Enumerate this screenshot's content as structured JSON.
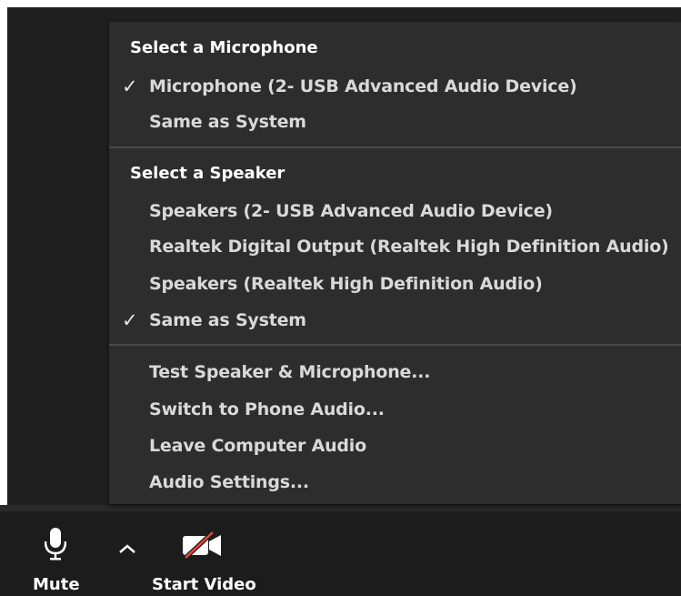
{
  "menu": {
    "microphone_header": "Select a Microphone",
    "microphones": [
      {
        "label": "Microphone (2- USB Advanced Audio Device)",
        "checked": true
      },
      {
        "label": "Same as System",
        "checked": false
      }
    ],
    "speaker_header": "Select a Speaker",
    "speakers": [
      {
        "label": "Speakers (2- USB Advanced Audio Device)",
        "checked": false
      },
      {
        "label": "Realtek Digital Output (Realtek High Definition Audio)",
        "checked": false
      },
      {
        "label": "Speakers (Realtek High Definition Audio)",
        "checked": false
      },
      {
        "label": "Same as System",
        "checked": true
      }
    ],
    "actions": [
      {
        "label": "Test Speaker & Microphone..."
      },
      {
        "label": "Switch to Phone Audio..."
      },
      {
        "label": "Leave Computer Audio"
      },
      {
        "label": "Audio Settings..."
      }
    ],
    "check_glyph": "✓"
  },
  "toolbar": {
    "mute_label": "Mute",
    "start_video_label": "Start Video",
    "mute_icon": "microphone-icon",
    "audio_options_icon": "chevron-up-icon",
    "video_icon": "video-camera-off-icon"
  },
  "colors": {
    "menu_bg": "#2d2d2d",
    "toolbar_bg": "#1c1c1c",
    "video_off_slash": "#e8453c"
  }
}
